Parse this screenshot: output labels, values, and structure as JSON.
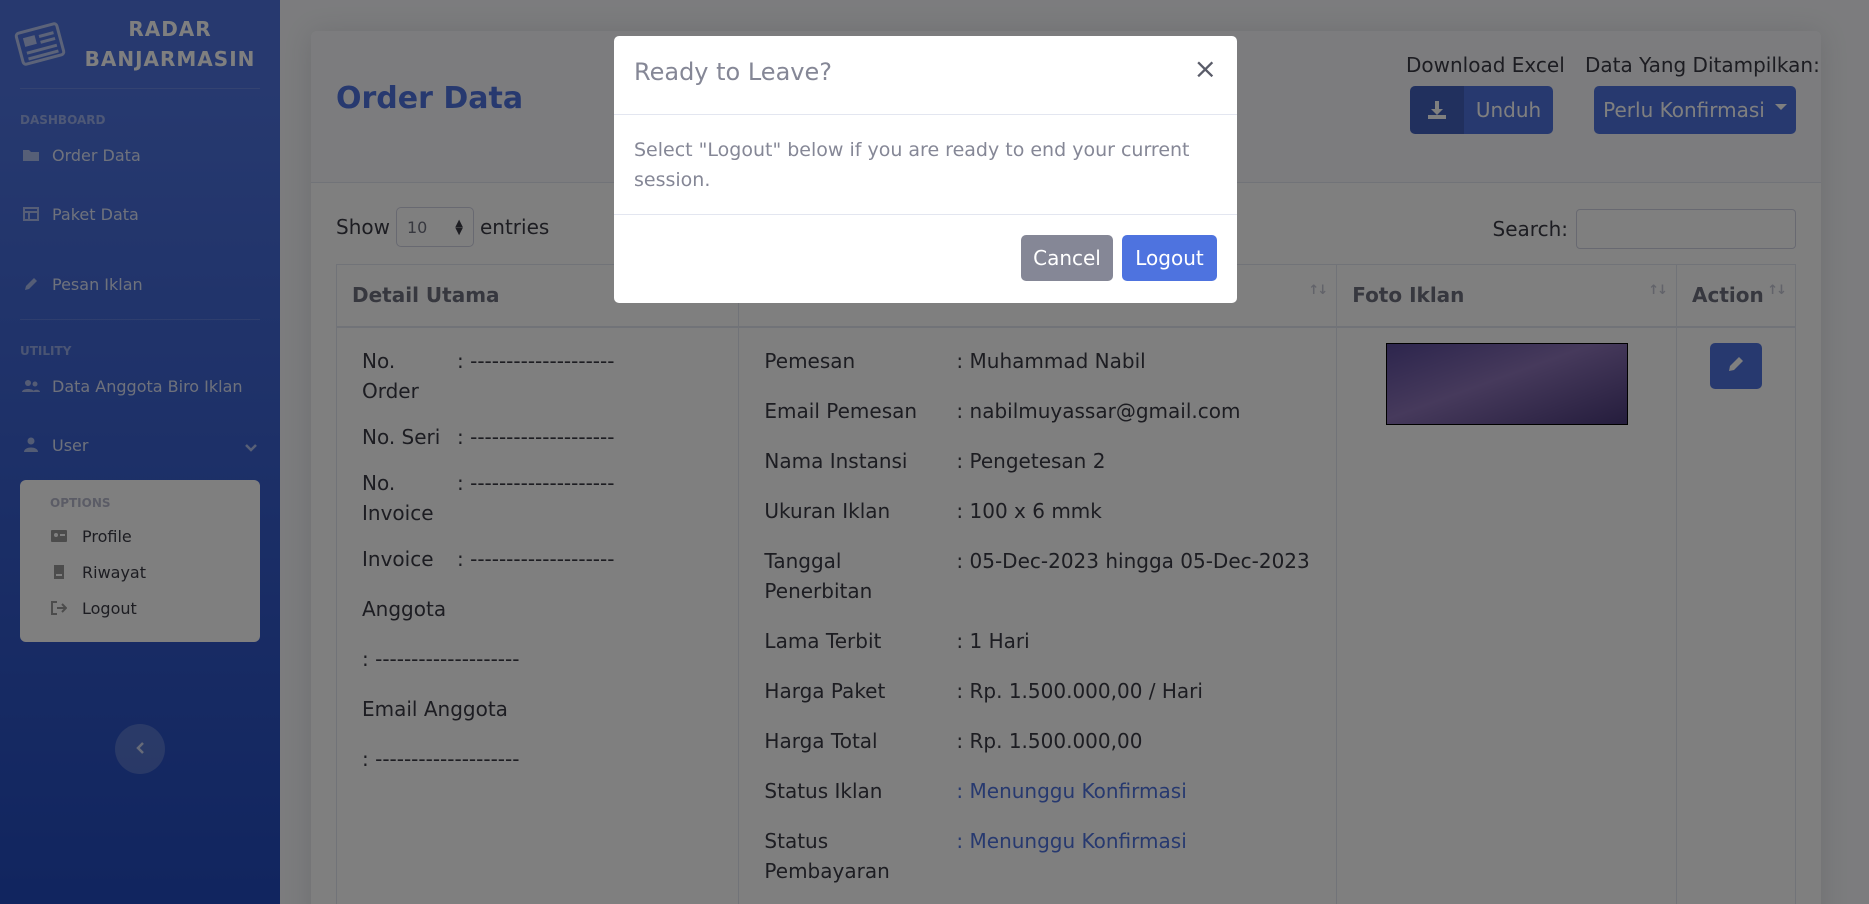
{
  "brand": {
    "line1": "RADAR",
    "line2": "BANJARMASIN",
    "icon": "newspaper-icon"
  },
  "sidebar": {
    "heading_dashboard": "DASHBOARD",
    "items": [
      {
        "label": "Order Data",
        "icon": "folder-open-icon"
      },
      {
        "label": "Paket Data",
        "icon": "table-icon"
      },
      {
        "label": "Pesan Iklan",
        "icon": "pen-icon"
      }
    ],
    "heading_utility": "UTILITY",
    "utility_items": [
      {
        "label": "Data Anggota Biro Iklan",
        "icon": "users-icon"
      },
      {
        "label": "User",
        "icon": "user-icon"
      }
    ],
    "options": {
      "heading": "OPTIONS",
      "items": [
        {
          "label": "Profile",
          "icon": "id-card-icon"
        },
        {
          "label": "Riwayat",
          "icon": "file-icon"
        },
        {
          "label": "Logout",
          "icon": "sign-out-icon"
        }
      ]
    }
  },
  "header": {
    "title": "Order Data",
    "download_label": "Download Excel",
    "download_button": "Unduh",
    "display_label": "Data Yang Ditampilkan:",
    "display_button": "Perlu Konfirmasi"
  },
  "table_controls": {
    "show": "Show",
    "entries_value": "10",
    "entries": "entries",
    "search": "Search:"
  },
  "table": {
    "headers": [
      "Detail Utama",
      "",
      "Foto Iklan",
      "Action"
    ],
    "detail_utama": [
      {
        "k": "No. Order",
        "v": ": --------------------"
      },
      {
        "k": "No. Seri",
        "v": ": --------------------"
      },
      {
        "k": "No. Invoice",
        "v": ": --------------------"
      },
      {
        "k": "Invoice",
        "v": ": --------------------"
      }
    ],
    "anggota_label": "Anggota",
    "anggota_value": ": --------------------",
    "email_anggota_label": "Email Anggota",
    "email_anggota_value": ": --------------------",
    "detail": [
      {
        "k": "Pemesan",
        "v": ": Muhammad Nabil"
      },
      {
        "k": "Email Pemesan",
        "v": ": nabilmuyassar@gmail.com"
      },
      {
        "k": "Nama Instansi",
        "v": ": Pengetesan 2"
      },
      {
        "k": "Ukuran Iklan",
        "v": ": 100 x 6 mmk"
      },
      {
        "k": "Tanggal Penerbitan",
        "v": ": 05-Dec-2023 hingga 05-Dec-2023"
      },
      {
        "k": "Lama Terbit",
        "v": ": 1 Hari"
      },
      {
        "k": "Harga Paket",
        "v": ": Rp. 1.500.000,00 / Hari"
      },
      {
        "k": "Harga Total",
        "v": ": Rp. 1.500.000,00"
      },
      {
        "k": "Status Iklan",
        "v": ": Menunggu Konfirmasi"
      },
      {
        "k": "Status Pembayaran",
        "v": ": Menunggu Konfirmasi"
      }
    ]
  },
  "modal": {
    "title": "Ready to Leave?",
    "close": "×",
    "body": "Select \"Logout\" below if you are ready to end your current session.",
    "cancel": "Cancel",
    "logout": "Logout"
  },
  "colors": {
    "primary": "#4e73df",
    "secondary": "#858796"
  }
}
